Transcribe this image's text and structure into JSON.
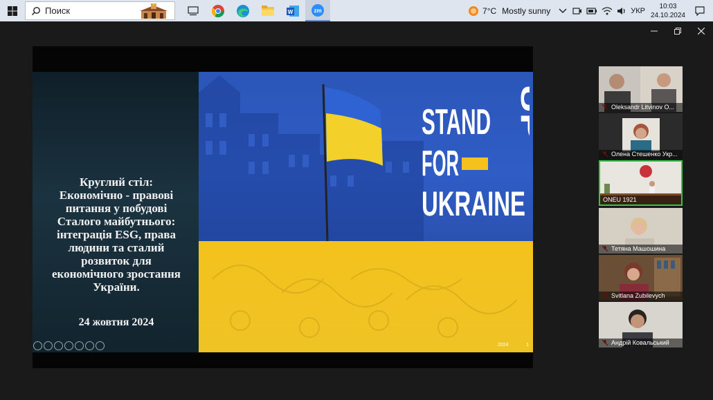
{
  "taskbar": {
    "search_label": "Поиск",
    "apps": [
      "task-view",
      "chrome",
      "edge",
      "file-explorer",
      "word",
      "zoom"
    ]
  },
  "tray": {
    "temperature": "7°C",
    "weather": "Mostly sunny",
    "language": "УКР",
    "time": "10:03",
    "date": "24.10.2024"
  },
  "slide": {
    "title_lines": [
      "Круглий стіл:",
      "Економічно - правові",
      "питання у побудові",
      "Сталого майбутнього:",
      "інтеграція ESG, права",
      "людини та сталий",
      "розвиток для",
      "економічного зростання",
      "України."
    ],
    "date": "24 жовтня 2024",
    "logo_lines": [
      "STAND",
      "UP",
      "FOR",
      "UKRAINE"
    ],
    "footer_year": "2024",
    "page_number": "1"
  },
  "participants": [
    {
      "name": "Oleksandr Litvinov O...",
      "muted": true
    },
    {
      "name": "Олена Стешенко Укр...",
      "muted": true
    },
    {
      "name": "ONEU 1921",
      "muted": false,
      "active": true
    },
    {
      "name": "Тетяна Машошина",
      "muted": true
    },
    {
      "name": "Svitlana Zubilevych",
      "muted": true
    },
    {
      "name": "Андрій Ковальський",
      "muted": true
    }
  ],
  "colors": {
    "ua_blue": "#2f5dc6",
    "ua_yellow": "#f3c21c",
    "active_speaker": "#2ecc40",
    "muted_icon": "#e02020"
  }
}
